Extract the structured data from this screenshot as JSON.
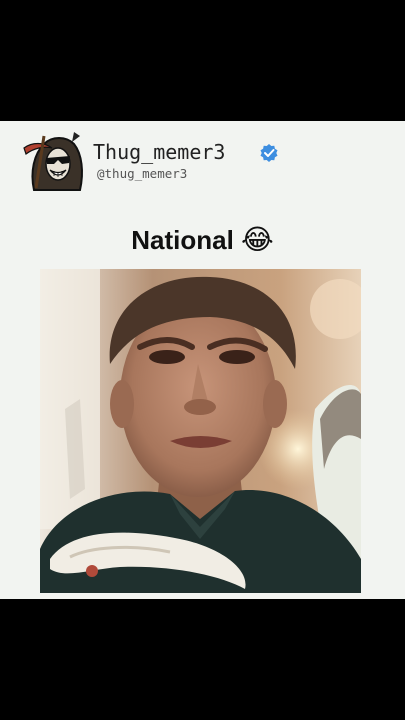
{
  "post": {
    "username": "Thug_memer3",
    "handle": "@thug_memer3",
    "caption": "National",
    "caption_emoji": "😂",
    "verified_color": "#3d8ee0",
    "background": "#f2f4f1"
  },
  "icons": {
    "avatar": "grim-reaper-sunglasses-avatar",
    "verified": "verified-badge-icon"
  }
}
